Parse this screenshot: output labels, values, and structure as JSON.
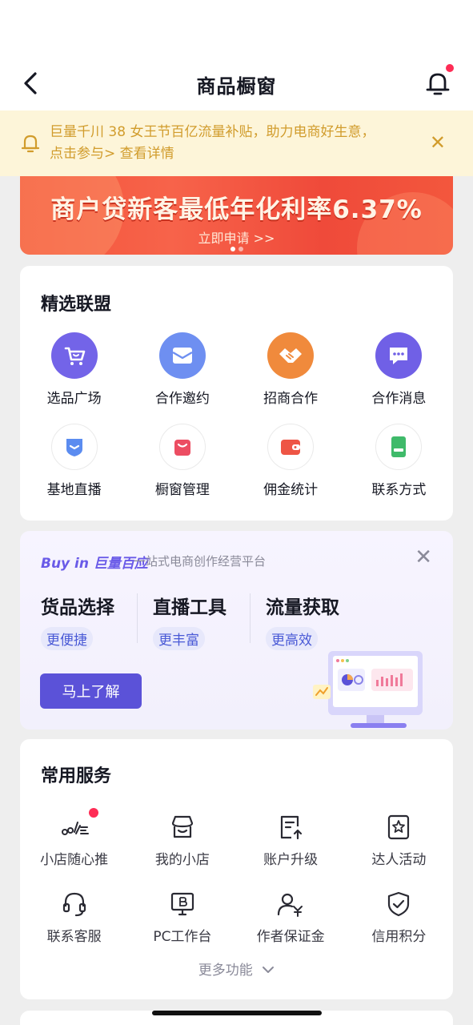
{
  "header": {
    "title": "商品橱窗"
  },
  "notice": {
    "line1": "巨量千川 38 女王节百亿流量补贴，助力电商好生意，",
    "line2": "点击参与> 查看详情",
    "close": "✕"
  },
  "banner": {
    "title": "商户贷新客最低年化利率6.37%",
    "cta": "立即申请 >>"
  },
  "alliance": {
    "title": "精选联盟",
    "items": [
      {
        "label": "选品广场",
        "icon": "cart-icon",
        "color": "#7364e8"
      },
      {
        "label": "合作邀约",
        "icon": "envelope-icon",
        "color": "#6e8ff1"
      },
      {
        "label": "招商合作",
        "icon": "handshake-icon",
        "color": "#f08a3c"
      },
      {
        "label": "合作消息",
        "icon": "chat-icon",
        "color": "#7060e6"
      },
      {
        "label": "基地直播",
        "icon": "shield-icon",
        "color": "#5b8cf0"
      },
      {
        "label": "橱窗管理",
        "icon": "bag-icon",
        "color": "#ec4d62"
      },
      {
        "label": "佣金统计",
        "icon": "wallet-icon",
        "color": "#ee5545"
      },
      {
        "label": "联系方式",
        "icon": "phone-icon",
        "color": "#3fba6a"
      }
    ]
  },
  "promo": {
    "brand": "Buy in 巨量百应",
    "subtitle": "一站式电商创作经营平台",
    "features": [
      {
        "title": "货品选择",
        "tag": "更便捷"
      },
      {
        "title": "直播工具",
        "tag": "更丰富"
      },
      {
        "title": "流量获取",
        "tag": "更高效"
      }
    ],
    "button": "马上了解",
    "close": "✕"
  },
  "services": {
    "title": "常用服务",
    "items": [
      {
        "label": "小店随心推",
        "icon": "boost-icon",
        "badge": true
      },
      {
        "label": "我的小店",
        "icon": "store-icon"
      },
      {
        "label": "账户升级",
        "icon": "upgrade-icon"
      },
      {
        "label": "达人活动",
        "icon": "star-badge-icon"
      },
      {
        "label": "联系客服",
        "icon": "headset-icon"
      },
      {
        "label": "PC工作台",
        "icon": "pc-workbench-icon"
      },
      {
        "label": "作者保证金",
        "icon": "deposit-icon"
      },
      {
        "label": "信用积分",
        "icon": "credit-shield-icon"
      }
    ],
    "more": "更多功能"
  }
}
